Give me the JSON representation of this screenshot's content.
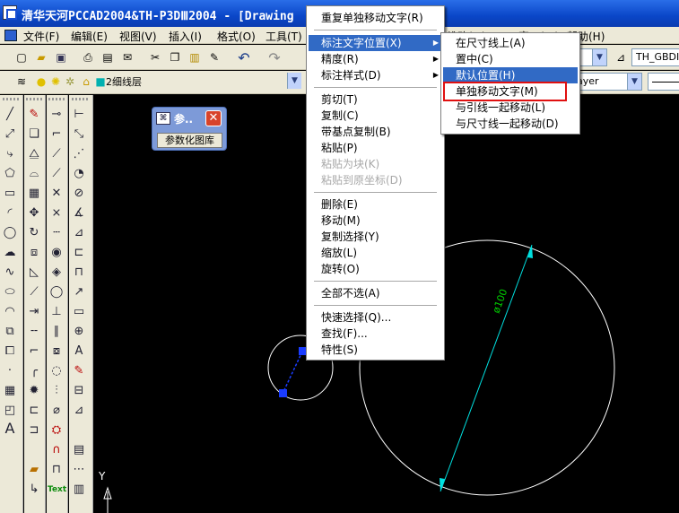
{
  "window": {
    "title": "清华天河PCCAD2004&TH-P3DⅢ2004 - [Drawing"
  },
  "menubar": {
    "items": [
      "文件(F)",
      "编辑(E)",
      "视图(V)",
      "插入(I)",
      "格式(O)",
      "工具(T)",
      "维改(M)",
      "窗口(W)",
      "帮助(H)"
    ]
  },
  "toolbar": {
    "dimstyle": "TH_GBDIM",
    "layer": "2细线层",
    "linetype": "ayer"
  },
  "palette": {
    "title": "参..",
    "button": "参数化图库"
  },
  "context_menu": {
    "items": [
      {
        "label": "重复单独移动文字(R)",
        "state": "normal"
      },
      {
        "label": "标注文字位置(X)",
        "state": "highlighted",
        "submenu": true
      },
      {
        "label": "精度(R)",
        "state": "normal",
        "submenu": true
      },
      {
        "label": "标注样式(D)",
        "state": "normal",
        "submenu": true
      },
      {
        "label": "剪切(T)",
        "state": "normal"
      },
      {
        "label": "复制(C)",
        "state": "normal"
      },
      {
        "label": "带基点复制(B)",
        "state": "normal"
      },
      {
        "label": "粘贴(P)",
        "state": "normal"
      },
      {
        "label": "粘贴为块(K)",
        "state": "disabled"
      },
      {
        "label": "粘贴到原坐标(D)",
        "state": "disabled"
      },
      {
        "label": "删除(E)",
        "state": "normal"
      },
      {
        "label": "移动(M)",
        "state": "normal"
      },
      {
        "label": "复制选择(Y)",
        "state": "normal"
      },
      {
        "label": "缩放(L)",
        "state": "normal"
      },
      {
        "label": "旋转(O)",
        "state": "normal"
      },
      {
        "label": "全部不选(A)",
        "state": "normal"
      },
      {
        "label": "快速选择(Q)...",
        "state": "normal"
      },
      {
        "label": "查找(F)...",
        "state": "normal"
      },
      {
        "label": "特性(S)",
        "state": "normal"
      }
    ]
  },
  "submenu": {
    "items": [
      {
        "label": "在尺寸线上(A)",
        "state": "normal"
      },
      {
        "label": "置中(C)",
        "state": "normal"
      },
      {
        "label": "默认位置(H)",
        "state": "highlighted"
      },
      {
        "label": "单独移动文字(M)",
        "state": "outlined"
      },
      {
        "label": "与引线一起移动(L)",
        "state": "normal"
      },
      {
        "label": "与尺寸线一起移动(D)",
        "state": "normal"
      }
    ]
  },
  "drawing": {
    "dimension_text": "ø100",
    "ucs_label": "Y"
  },
  "left_toolbar": {
    "text_button": "Text"
  },
  "colors": {
    "titlebar": "#0a46c8",
    "highlight": "#316ac5",
    "outline": "#e01010",
    "dim_line": "#00e0e0",
    "dim_text": "#00d000",
    "grip": "#1a3cff"
  }
}
